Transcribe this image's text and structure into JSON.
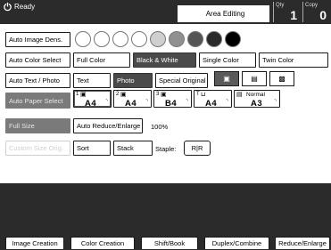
{
  "header": {
    "status": "Ready",
    "mode": "Area Editing",
    "qty_label": "Qty",
    "qty_value": "1",
    "copy_label": "Copy",
    "copy_value": "0"
  },
  "density": {
    "label": "Auto Image Dens."
  },
  "color_row": {
    "auto": "Auto Color Select",
    "full": "Full Color",
    "bw": "Black & White",
    "single": "Single Color",
    "twin": "Twin Color"
  },
  "text_row": {
    "label": "Auto Text / Photo",
    "text": "Text",
    "photo1": "Photo",
    "photo2": "Photo",
    "special": "Special Original"
  },
  "paper_row": {
    "label": "Auto Paper Select",
    "trays": [
      {
        "num": "1",
        "size": "A4",
        "orient": "▭"
      },
      {
        "num": "2",
        "size": "A4",
        "orient": "▭"
      },
      {
        "num": "3",
        "size": "B4",
        "orient": "▭"
      },
      {
        "num": "T",
        "size": "A4",
        "orient": "▭"
      },
      {
        "num": "",
        "size": "A3",
        "orient": "▭",
        "extra": "Normal"
      }
    ]
  },
  "size_row": {
    "full": "Full Size",
    "auto_reduce": "Auto Reduce/Enlarge",
    "percent": "100%"
  },
  "finish_row": {
    "custom": "Custom Size Orig.",
    "sort": "Sort",
    "stack": "Stack",
    "staple": "Staple:",
    "staple_icon": "R|R"
  },
  "tabs": [
    "Image Creation",
    "Color Creation",
    "Shift/Book",
    "Duplex/Combine",
    "Reduce/Enlarge"
  ]
}
